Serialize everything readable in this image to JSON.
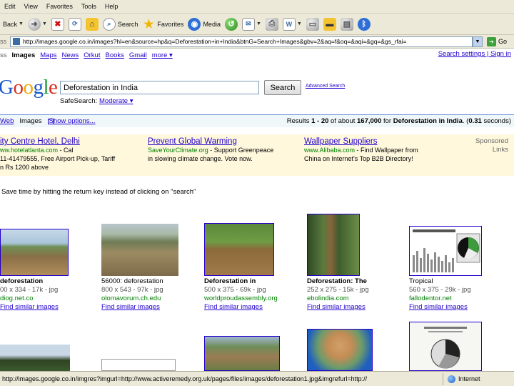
{
  "menu": [
    "Edit",
    "View",
    "Favorites",
    "Tools",
    "Help"
  ],
  "toolbar": {
    "back": "Back",
    "search": "Search",
    "favorites": "Favorites",
    "media": "Media"
  },
  "address": {
    "label": "ss",
    "url": "http://images.google.co.in/images?hl=en&source=hp&q=Deforestation+in+India&btnG=Search+Images&gbv=2&aq=f&oq=&aqi=&gq=&gs_rfai=",
    "go": "Go"
  },
  "gnav": {
    "items": [
      "Images",
      "Maps",
      "News",
      "Orkut",
      "Books",
      "Gmail",
      "more ▾"
    ],
    "first": "ss",
    "right": "Search settings | Sign in"
  },
  "logo": {
    "b1": "G",
    "r1": "o",
    "y1": "o",
    "b2": "g",
    "g1": "l",
    "r2": "e",
    "prefix": "o"
  },
  "search": {
    "query": "Deforestation in India",
    "button": "Search",
    "advanced": "Advanced Search",
    "safesearch_label": "SafeSearch:",
    "safesearch_value": "Moderate ▾"
  },
  "resultsbar": {
    "web": "Web",
    "images": "Images",
    "show_options": "Show options...",
    "stats_prefix": "Results ",
    "range": "1 - 20",
    "stats_mid": " of about ",
    "count": "167,000",
    "stats_for": " for ",
    "query": "Deforestation in India",
    "time": "0.31",
    "stats_suffix": " seconds)"
  },
  "ads": [
    {
      "title": "ity Centre Hotel, Delhi",
      "url": "ww.hotelatlanta.com",
      "line1": " - Cal",
      "line2": "11-41479555, Free Airport Pick-up, Tariff",
      "line3": "n Rs 1200 above"
    },
    {
      "title": "Prevent Global Warming",
      "url": "SaveYourClimate.org",
      "line1": " - Support Greenpeace",
      "line2": "in slowing climate change. Vote now."
    },
    {
      "title": "Wallpaper Suppliers",
      "url": "www.Alibaba.com",
      "line1": " - Find Wallpaper from",
      "line2": "China on Internet's Top B2B Directory!"
    }
  ],
  "sponsored": "Sponsored Links",
  "tip": "Save time by hitting the return key instead of clicking on \"search\"",
  "results": [
    {
      "title": "deforestation",
      "bold": true,
      "dims": "00 x 334 - 17k - jpg",
      "site": "diog.net.co",
      "similar": "Find similar images"
    },
    {
      "title": "56000: deforestation",
      "bold": false,
      "dims": "800 x 543 - 97k - jpg",
      "site": "olomavorum.ch.edu",
      "similar": "Find similar images"
    },
    {
      "title": "Deforestation in",
      "bold": true,
      "dims": "500 x 375 - 69k - jpg",
      "site": "worldproudassembly.org",
      "similar": "Find similar images"
    },
    {
      "title": "Deforestation: The",
      "bold": true,
      "dims": "252 x 275 - 15k - jpg",
      "site": "ebolindia.com",
      "similar": "Find similar images"
    },
    {
      "title": "Tropical",
      "bold": false,
      "dims": "560 x 375 - 29k - jpg",
      "site": "fallodentor.net",
      "similar": "Find similar images"
    }
  ],
  "status": {
    "url": "http://images.google.co.in/imgres?imgurl=http://www.activeremedy.org.uk/pages/files/images/deforestation1.jpg&imgrefurl=http://",
    "zone": "Internet"
  }
}
